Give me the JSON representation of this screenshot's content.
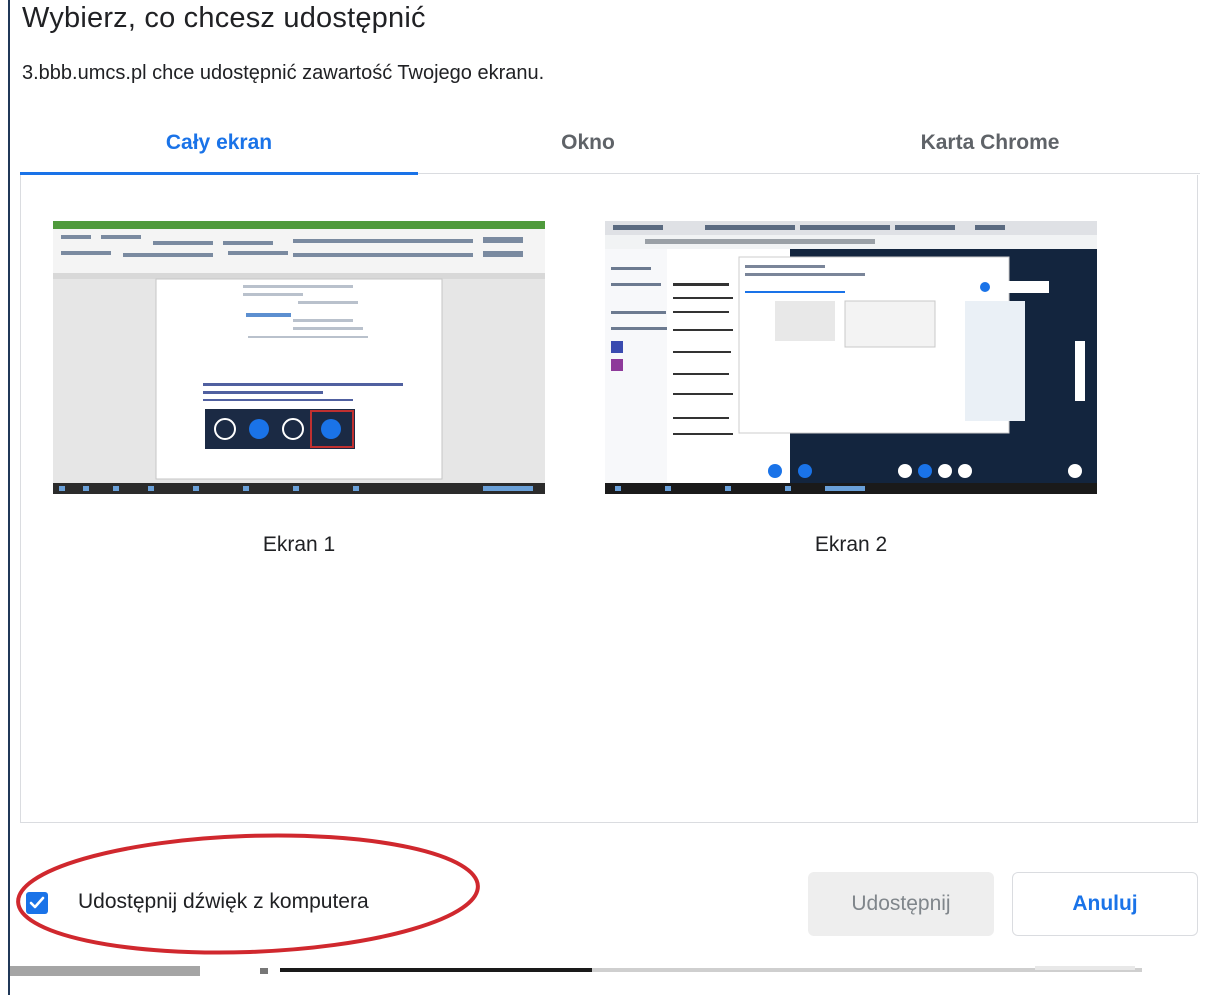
{
  "dialog": {
    "title": "Wybierz, co chcesz udostępnić",
    "subtitle": "3.bbb.umcs.pl chce udostępnić zawartość Twojego ekranu."
  },
  "tabs": [
    {
      "label": "Cały ekran",
      "active": true
    },
    {
      "label": "Okno",
      "active": false
    },
    {
      "label": "Karta Chrome",
      "active": false
    }
  ],
  "screens": [
    {
      "label": "Ekran 1",
      "icon": "screen-thumbnail-word"
    },
    {
      "label": "Ekran 2",
      "icon": "screen-thumbnail-browser"
    }
  ],
  "audio_option": {
    "label": "Udostępnij dźwięk z komputera",
    "checked": true
  },
  "buttons": {
    "share": "Udostępnij",
    "cancel": "Anuluj"
  },
  "colors": {
    "accent": "#1a73e8",
    "annotation": "#d0282e"
  }
}
